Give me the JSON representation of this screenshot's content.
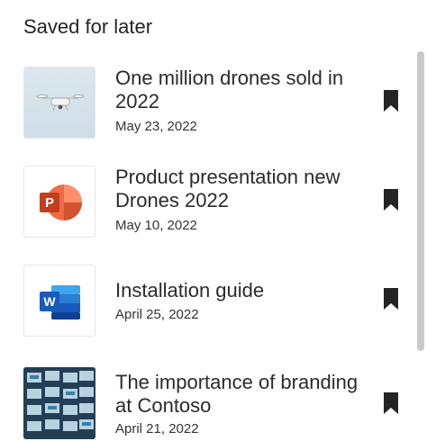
{
  "panel": {
    "title": "Saved for later"
  },
  "items": [
    {
      "title": "One million drones sold in 2022",
      "date": "May 23, 2022",
      "thumb_icon": "drone-photo"
    },
    {
      "title": "Product presentation new Drones 2022",
      "date": "May 10, 2022",
      "thumb_icon": "powerpoint-icon"
    },
    {
      "title": "Installation guide",
      "date": "April 25, 2022",
      "thumb_icon": "word-icon"
    },
    {
      "title": "The importance of branding at Contoso",
      "date": "April 21, 2022",
      "thumb_icon": "slides-collage"
    }
  ],
  "colors": {
    "text": "#242424",
    "powerpoint": "#D24726",
    "word": "#185ABD",
    "bookmark": "#242424",
    "scrollbar": "#c9c9c9"
  }
}
